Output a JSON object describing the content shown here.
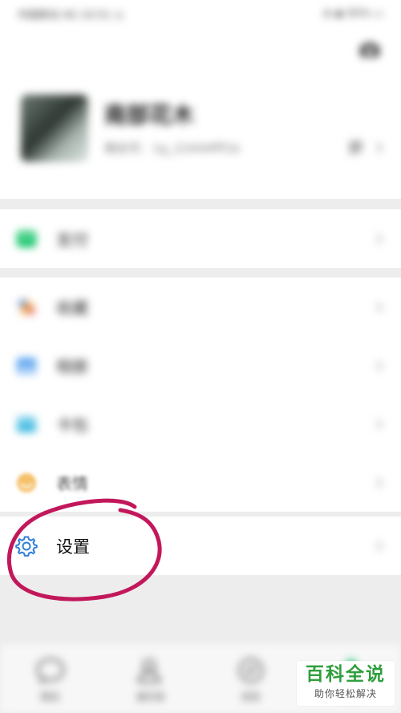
{
  "status_bar": {
    "left": "中国移动 4G 10:51 ◷",
    "right": "◔ ◉ 95% ▭"
  },
  "profile": {
    "nickname": "南部花木",
    "wechat_id": "微信号：1g_22444fff1b"
  },
  "menu": {
    "pay": "支付",
    "favorites": "收藏",
    "album": "相册",
    "cards": "卡包",
    "stickers": "表情",
    "settings": "设置"
  },
  "bottom_nav": [
    {
      "label": "微信",
      "icon": "chat-bubble-icon"
    },
    {
      "label": "通讯录",
      "icon": "contacts-icon"
    },
    {
      "label": "发现",
      "icon": "compass-icon"
    },
    {
      "label": "我",
      "icon": "person-icon"
    }
  ],
  "watermark": {
    "title": "百科全说",
    "subtitle": "助你轻松解决"
  },
  "colors": {
    "accent_green": "#07c160",
    "annotation_pink": "#c2185b",
    "settings_icon_blue": "#2f7fd6"
  }
}
